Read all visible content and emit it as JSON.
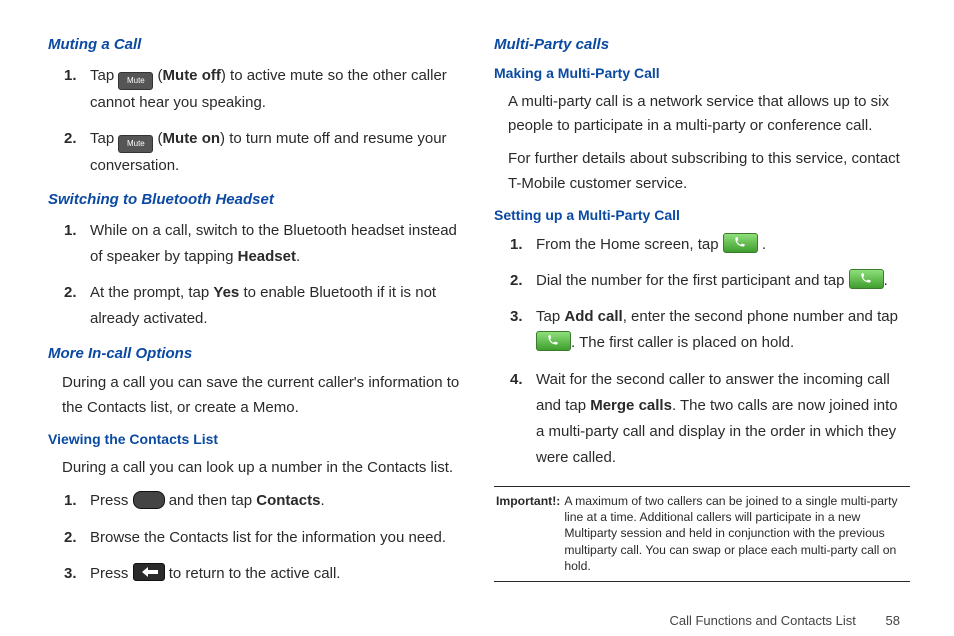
{
  "left": {
    "muting": {
      "heading": "Muting a Call",
      "steps": [
        {
          "pre": "Tap ",
          "icon_label": "Mute",
          "post1": " (",
          "bold": "Mute off",
          "post2": ") to active mute so the other caller cannot hear you speaking."
        },
        {
          "pre": "Tap ",
          "icon_label": "Mute",
          "post1": " (",
          "bold": "Mute on",
          "post2": ") to turn mute off and resume your conversation."
        }
      ]
    },
    "bluetooth": {
      "heading": "Switching to Bluetooth Headset",
      "steps": [
        {
          "pre": "While on a call, switch to the Bluetooth headset instead of speaker by tapping ",
          "bold": "Headset",
          "post": "."
        },
        {
          "pre": "At the prompt, tap ",
          "bold": "Yes",
          "post": " to enable Bluetooth if it is not already activated."
        }
      ]
    },
    "more": {
      "heading": "More In-call Options",
      "body": "During a call you can save the current caller's information to the Contacts list, or create a Memo."
    },
    "contacts": {
      "heading": "Viewing the Contacts List",
      "body": "During a call you can look up a number in the Contacts list.",
      "steps": [
        {
          "pre": "Press ",
          "post1": " and then tap ",
          "bold": "Contacts",
          "post2": "."
        },
        {
          "text": "Browse the Contacts list for the information you need."
        },
        {
          "pre": "Press ",
          "post": " to return to the active call."
        }
      ]
    }
  },
  "right": {
    "multi": {
      "heading": "Multi-Party calls"
    },
    "making": {
      "heading": "Making a Multi-Party Call",
      "body1": "A multi-party call is a network service that allows up to six people to participate in a multi-party or conference call.",
      "body2": "For further details about subscribing to this service, contact T-Mobile customer service."
    },
    "setting": {
      "heading": "Setting up a Multi-Party Call",
      "steps": [
        {
          "pre": "From the Home screen, tap ",
          "post": " ."
        },
        {
          "pre": "Dial the number for the first participant and tap ",
          "post": "."
        },
        {
          "pre": "Tap ",
          "bold1": "Add call",
          "mid": ", enter the second phone number and tap ",
          "post": ". The first caller is placed on hold."
        },
        {
          "pre": "Wait for the second caller to answer the incoming call and tap ",
          "bold1": "Merge calls",
          "post": ". The two calls are now joined into a multi-party call and display in the order in which they were called."
        }
      ]
    },
    "important": {
      "label": "Important!:",
      "text": "A maximum of two callers can be joined to a single multi-party line at a time. Additional callers will participate in a new Multiparty session and held in conjunction with the previous multiparty call. You can swap or place each multi-party call on hold."
    }
  },
  "footer": {
    "section": "Call Functions and Contacts List",
    "page": "58"
  }
}
